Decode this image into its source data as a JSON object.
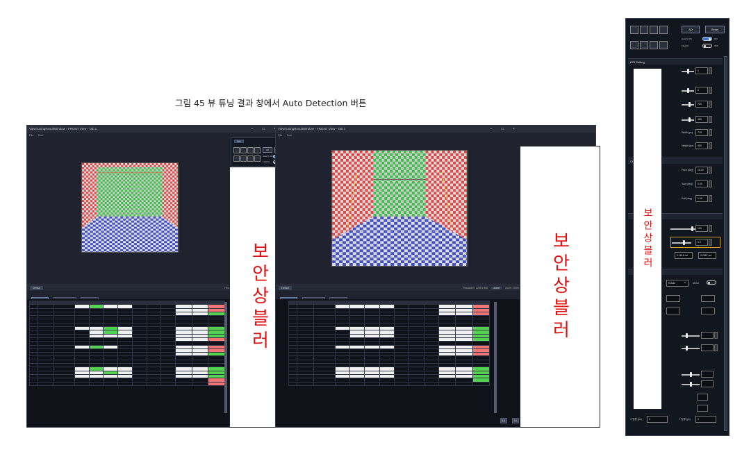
{
  "caption": "그림 45 뷰 튜닝 결과 창에서 Auto Detection 버튼",
  "windows": [
    {
      "title": "ViewTuningResultWindow - FRONT View - Tab 1",
      "menu": [
        "File",
        "Tool"
      ],
      "controls": "–  □  ×",
      "status_tab": "Default",
      "status_items": [
        "Resolution: 1280 x 960",
        "Zoom",
        "Zoom: 100%"
      ],
      "status_chip": "Resolution",
      "tabs": [
        "직선성",
        "씨앗 확인점",
        "설정값"
      ],
      "buttons": [
        "완료",
        "취소"
      ]
    },
    {
      "title": "ViewTuningResultWindow - FRONT View - Tab 1",
      "menu": [
        "File",
        "Tool"
      ],
      "controls": "–  □  ×",
      "status_tab": "Default",
      "status_items": [
        "Resolution: 1280 x 960",
        "Zoom",
        "Zoom: 100%"
      ],
      "status_chip": "Resolution",
      "tabs": [
        "직선성",
        "씨앗 확인점",
        "설정값"
      ],
      "buttons": [
        "완료",
        "취소"
      ]
    }
  ],
  "censor_text": "보안상블러",
  "popup": {
    "tab": "Auto",
    "btn1": "AD",
    "btn2": "Reset",
    "toggle1_label": "Auto(Y Ch)",
    "toggle1_state": "ON",
    "toggle2_label": "Flat(Cl)",
    "toggle2_state": "OFF"
  },
  "right_panel": {
    "btn1": "AD",
    "btn2": "Reset",
    "toggle1_label": "Auto(Y Ch)",
    "toggle1_state": "ON",
    "toggle2_label": "Flat(Cl)",
    "toggle2_state": "OFF",
    "section_roi": "ROI Setting",
    "roi_values": [
      "0",
      "0",
      "720",
      "480"
    ],
    "width_label": "Width (px)",
    "width_value": "720",
    "height_label": "Height (px)",
    "height_value": "480",
    "section_angle": "Cb Angle",
    "pitch_label": "Pitch (deg)",
    "pitch_value": "16.20",
    "yaw_label": "Yaw (deg)",
    "yaw_value": "0.00",
    "roll_label": "Roll (deg)",
    "roll_value": "1.00",
    "slider_values": [
      "100",
      "0.0"
    ],
    "coords": [
      "0.1616 nd",
      "0.2687 nd"
    ],
    "mode_label": "Rotate",
    "mirror_label": "Mirror",
    "bottom_fields": [
      "0",
      "0"
    ],
    "bottom_labels": [
      "X 방향 (px)",
      "Y 방향 (px)"
    ]
  }
}
